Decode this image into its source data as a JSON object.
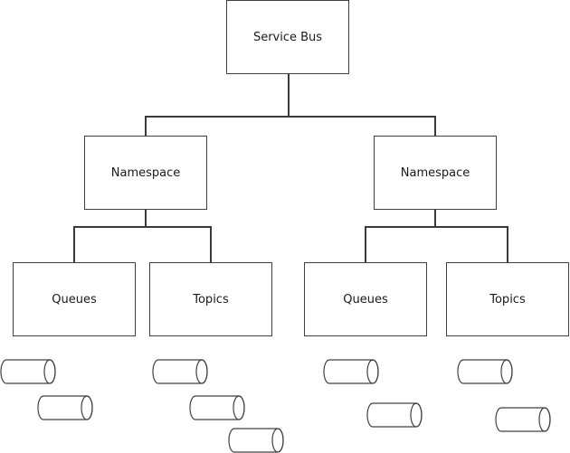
{
  "diagram": {
    "root": {
      "label": "Service Bus"
    },
    "namespaces": [
      {
        "label": "Namespace",
        "children": [
          {
            "label": "Queues",
            "entity_count": 2
          },
          {
            "label": "Topics",
            "entity_count": 3
          }
        ]
      },
      {
        "label": "Namespace",
        "children": [
          {
            "label": "Queues",
            "entity_count": 2
          },
          {
            "label": "Topics",
            "entity_count": 2
          }
        ]
      }
    ],
    "colors": {
      "stroke": "#404040",
      "background": "#ffffff",
      "text": "#1a1a1a"
    }
  }
}
